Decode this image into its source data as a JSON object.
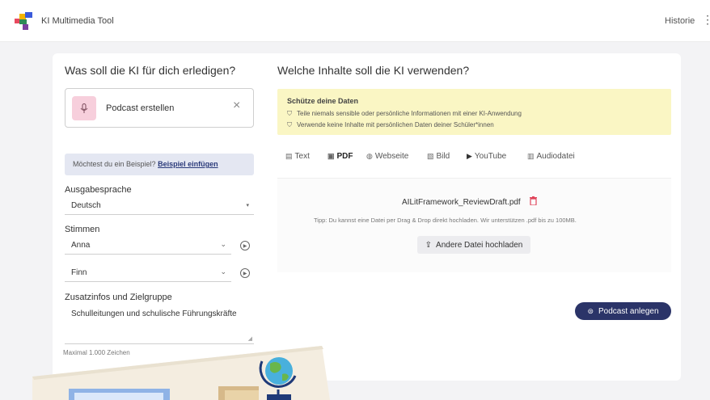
{
  "header": {
    "app_title": "KI Multimedia Tool",
    "history_label": "Historie",
    "menu_icon": "kebab-icon"
  },
  "left": {
    "heading": "Was soll die KI für dich erledigen?",
    "task": {
      "label": "Podcast erstellen",
      "icon": "microphone-icon",
      "close_icon": "close-icon"
    },
    "example": {
      "text": "Möchtest du ein Beispiel?",
      "link": "Beispiel einfügen"
    },
    "output_language": {
      "label": "Ausgabesprache",
      "value": "Deutsch"
    },
    "voices": {
      "label": "Stimmen",
      "voice1": "Anna",
      "voice2": "Finn"
    },
    "extra": {
      "label": "Zusatzinfos und Zielgruppe",
      "value": "Schulleitungen und schulische Führungskräfte",
      "max_chars": "Maximal 1.000 Zeichen"
    }
  },
  "right": {
    "heading": "Welche Inhalte soll die KI verwenden?",
    "privacy": {
      "title": "Schütze deine Daten",
      "items": [
        "Teile niemals sensible oder persönliche Informationen mit einer KI-Anwendung",
        "Verwende keine Inhalte mit persönlichen Daten deiner Schüler*innen"
      ]
    },
    "tabs": [
      "Text",
      "PDF",
      "Webseite",
      "Bild",
      "YouTube",
      "Audiodatei"
    ],
    "active_tab": "PDF",
    "upload": {
      "filename": "AILitFramework_ReviewDraft.pdf",
      "hint": "Tipp: Du kannst eine Datei per Drag & Drop direkt hochladen. Wir unterstützen .pdf bis zu 100MB.",
      "other_button": "Andere Datei hochladen"
    },
    "submit_button": "Podcast anlegen"
  },
  "colors": {
    "accent": "#2b3468",
    "privacy_bg": "#faf6c4",
    "example_bg": "#e4e7f2",
    "mic_bg": "#f7cfdc",
    "trash": "#e0445a"
  }
}
